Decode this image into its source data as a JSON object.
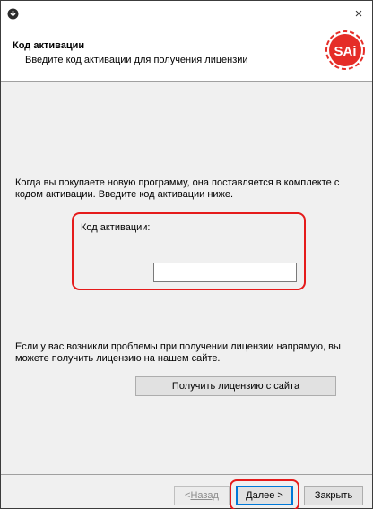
{
  "window": {
    "close_glyph": "×"
  },
  "header": {
    "title": "Код активации",
    "subtitle": "Введите код активации для получения лицензии",
    "logo_text": "SAi",
    "logo_color": "#e52d27"
  },
  "main": {
    "intro_text": "Когда вы покупаете новую программу, она поставляется в комплекте с кодом активации.  Введите код активации ниже.",
    "code_label": "Код активации:",
    "code_value": "",
    "problem_text": "Если у вас возникли проблемы при получении лицензии напрямую, вы можете получить лицензию на нашем сайте.",
    "get_license_button": "Получить лицензию с сайта"
  },
  "footer": {
    "back_prefix": "< ",
    "back_label": "Назад",
    "next_label": "Далее >",
    "close_label": "Закрыть"
  },
  "colors": {
    "highlight": "#e51b1b",
    "focus_border": "#0078d7"
  }
}
